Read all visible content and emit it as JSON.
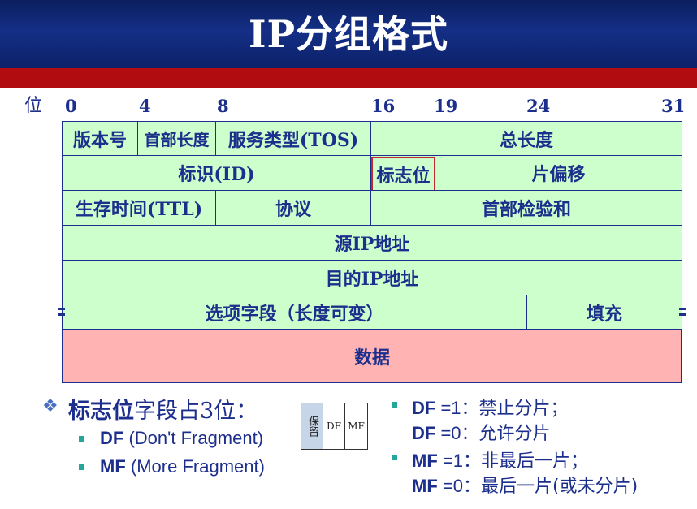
{
  "title": "IP分组格式",
  "bit_axis": {
    "label": "位",
    "ticks": [
      "0",
      "4",
      "8",
      "16",
      "19",
      "24",
      "31"
    ]
  },
  "rows": {
    "r1": {
      "version": "版本号",
      "header_length": "首部长度",
      "tos": "服务类型(TOS)",
      "total_length": "总长度"
    },
    "r2": {
      "id": "标识(ID)",
      "flags": "标志位",
      "fragment_offset": "片偏移"
    },
    "r3": {
      "ttl": "生存时间(TTL)",
      "protocol": "协议",
      "checksum": "首部检验和"
    },
    "r4": {
      "src": "源IP地址"
    },
    "r5": {
      "dst": "目的IP地址"
    },
    "r6": {
      "options": "选项字段（长度可变）",
      "padding": "填充"
    },
    "data": "数据"
  },
  "notes": {
    "heading_bold": "标志位",
    "heading_rest": "字段占3位：",
    "df_abbr": "DF",
    "df_full": "(Don't Fragment)",
    "mf_abbr": "MF",
    "mf_full": "(More Fragment)",
    "mini_diagram": {
      "reserved": "保留",
      "df": "DF",
      "mf": "MF"
    },
    "df_1_label": "DF",
    "df_1_value": "=1",
    "df_1_text": "：禁止分片；",
    "df_0_label": "DF",
    "df_0_value": "=0",
    "df_0_text": "：允许分片",
    "mf_1_label": "MF",
    "mf_1_value": "=1",
    "mf_1_text": "：非最后一片；",
    "mf_0_label": "MF",
    "mf_0_value": "=0",
    "mf_0_text": "：最后一片(或未分片)"
  },
  "colors": {
    "header_bg": "#142f86",
    "red_bar": "#b10d10",
    "field_green": "#ccffcc",
    "data_pink": "#ffb3b3",
    "text_blue": "#1c2f8c",
    "flag_highlight": "#c0292b"
  }
}
